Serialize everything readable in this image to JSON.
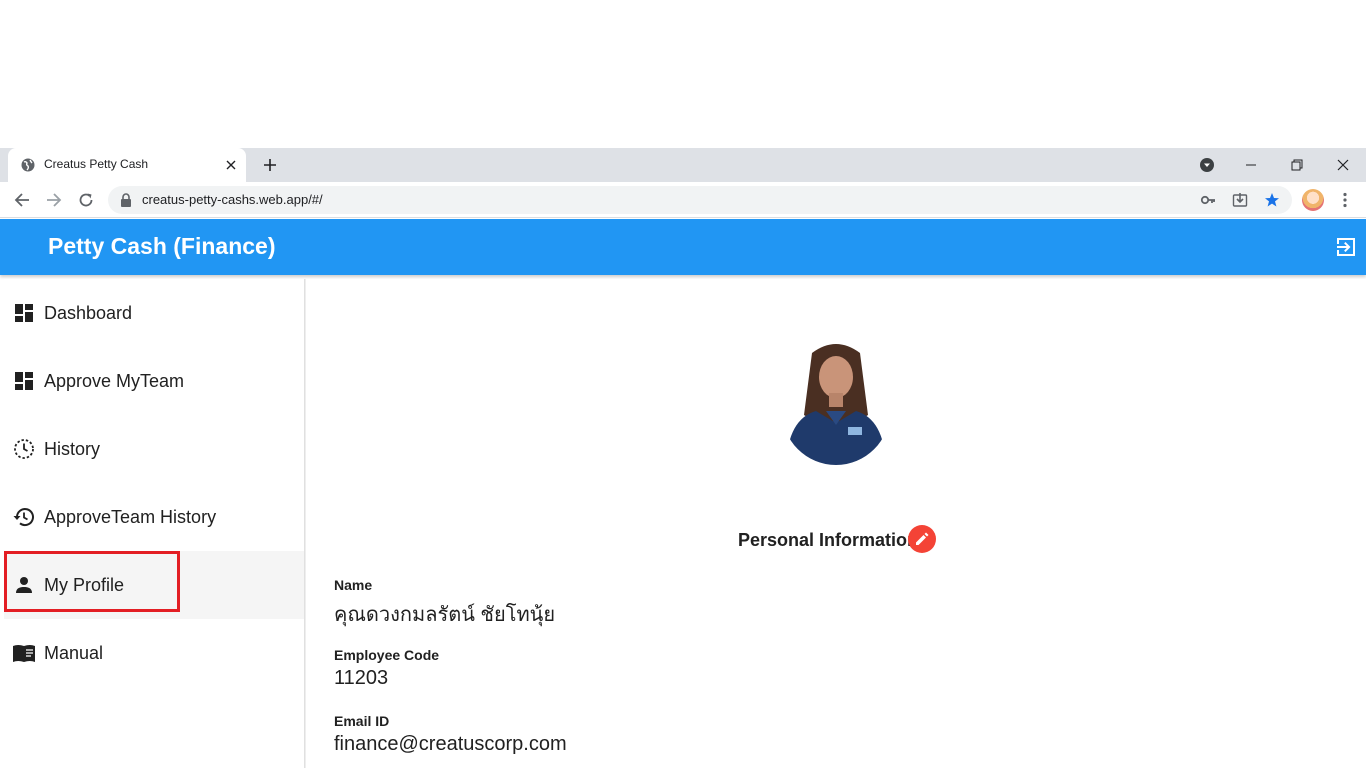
{
  "browser": {
    "tab_title": "Creatus Petty Cash",
    "url": "creatus-petty-cashs.web.app/#/"
  },
  "app": {
    "title": "Petty Cash (Finance)",
    "accent_color": "#2196f3"
  },
  "sidebar": {
    "items": [
      {
        "label": "Dashboard",
        "icon": "dashboard-icon"
      },
      {
        "label": "Approve MyTeam",
        "icon": "dashboard-icon"
      },
      {
        "label": "History",
        "icon": "history-clock-icon"
      },
      {
        "label": "ApproveTeam History",
        "icon": "restore-icon"
      },
      {
        "label": "My Profile",
        "icon": "person-icon",
        "active": true
      },
      {
        "label": "Manual",
        "icon": "book-icon"
      }
    ]
  },
  "profile": {
    "section_title": "Personal Information",
    "fields": [
      {
        "label": "Name",
        "value": "คุณดวงกมลรัตน์ ชัยโทนุ้ย"
      },
      {
        "label": "Employee Code",
        "value": "11203"
      },
      {
        "label": "Email ID",
        "value": "finance@creatuscorp.com"
      }
    ]
  }
}
